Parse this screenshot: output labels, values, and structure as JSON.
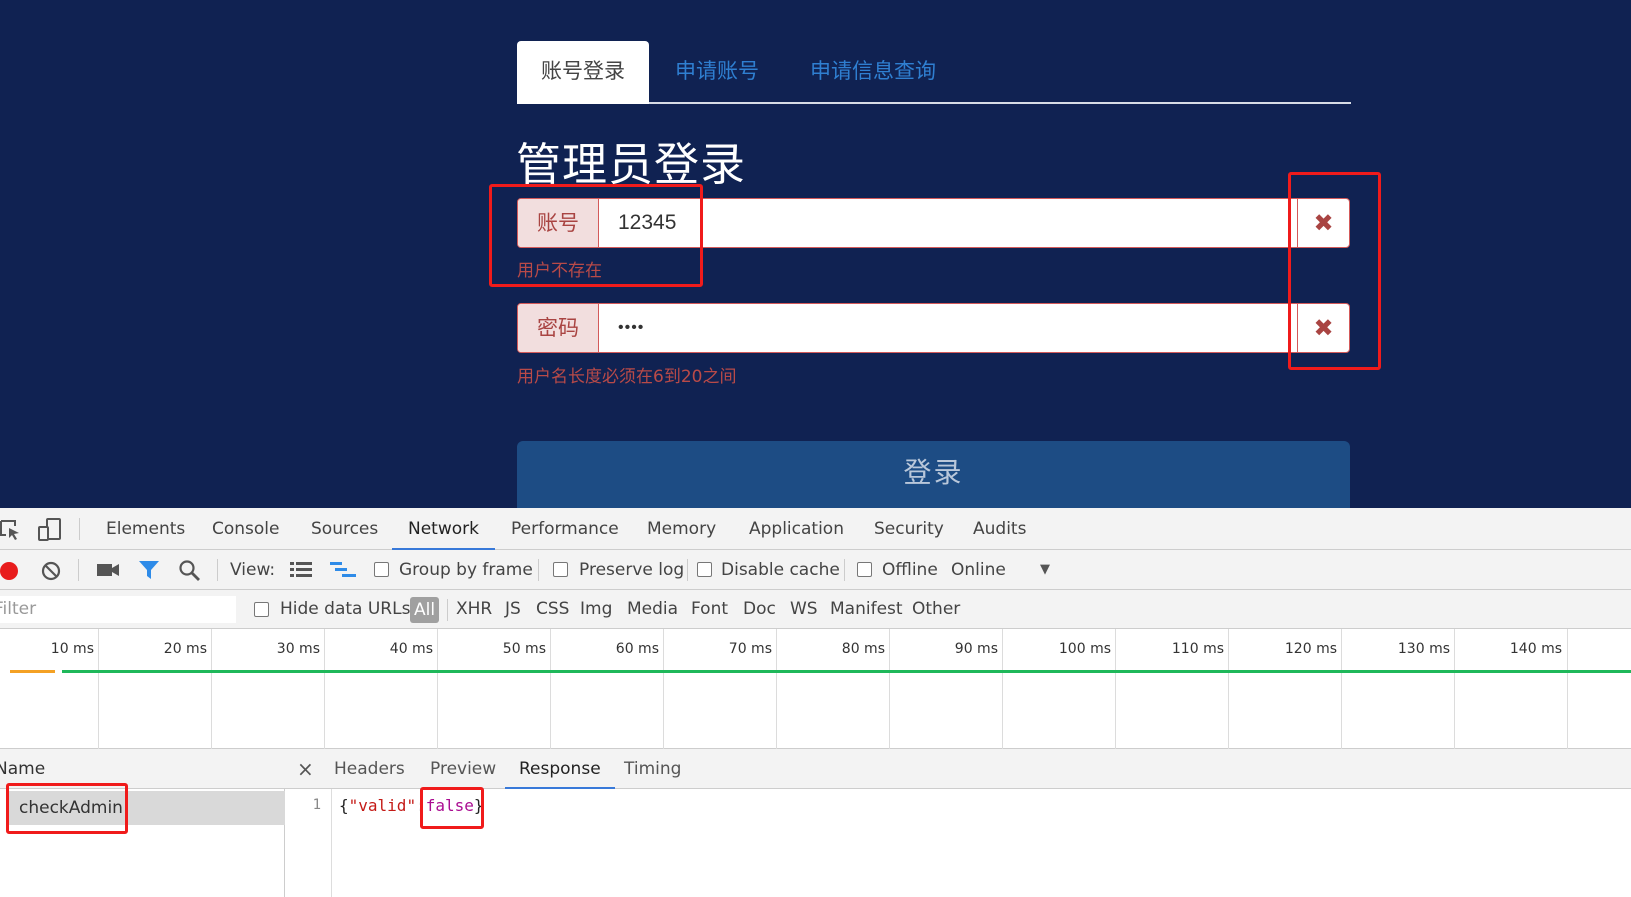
{
  "login": {
    "tabs": [
      "账号登录",
      "申请账号",
      "申请信息查询"
    ],
    "title": "管理员登录",
    "account": {
      "label": "账号",
      "value": "12345",
      "error": "用户不存在",
      "clear_icon": "✖"
    },
    "password": {
      "label": "密码",
      "value": "••••",
      "error": "用户名长度必须在6到20之间",
      "clear_icon": "✖"
    },
    "submit_label": "登录"
  },
  "devtools": {
    "tabs": [
      "Elements",
      "Console",
      "Sources",
      "Network",
      "Performance",
      "Memory",
      "Application",
      "Security",
      "Audits"
    ],
    "active_tab": "Network",
    "toolbar": {
      "view_label": "View:",
      "group_by_frame": "Group by frame",
      "preserve_log": "Preserve log",
      "disable_cache": "Disable cache",
      "offline": "Offline",
      "throttle": "Online",
      "dropdown_arrow": "▼"
    },
    "filterbar": {
      "filter_placeholder": "Filter",
      "hide_data_urls": "Hide data URLs",
      "types": [
        "All",
        "XHR",
        "JS",
        "CSS",
        "Img",
        "Media",
        "Font",
        "Doc",
        "WS",
        "Manifest",
        "Other"
      ]
    },
    "timeline_ticks": [
      "10 ms",
      "20 ms",
      "30 ms",
      "40 ms",
      "50 ms",
      "60 ms",
      "70 ms",
      "80 ms",
      "90 ms",
      "100 ms",
      "110 ms",
      "120 ms",
      "130 ms",
      "140 ms"
    ],
    "name_column": "Name",
    "request_name": "checkAdmin",
    "detail_tabs": [
      "Headers",
      "Preview",
      "Response",
      "Timing"
    ],
    "active_detail_tab": "Response",
    "close_icon": "×",
    "response": {
      "line_number": "1",
      "open": "{",
      "key": "\"valid\"",
      "colon": ":",
      "value": "false",
      "close": "}"
    }
  }
}
